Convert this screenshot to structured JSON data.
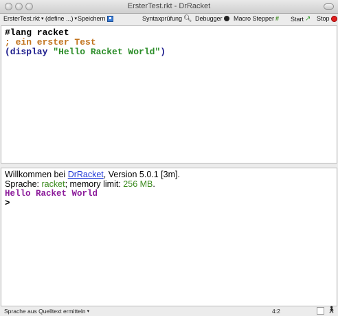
{
  "window": {
    "title": "ErsterTest.rkt - DrRacket"
  },
  "toolbar": {
    "file_menu": "ErsterTest.rkt",
    "define_menu": "(define ...)",
    "save": "Speichern",
    "check_syntax": "Syntaxprüfung",
    "debugger": "Debugger",
    "macro_stepper": "Macro Stepper",
    "macro_stepper_mark": "#",
    "run": "Start",
    "stop": "Stop",
    "dropdown_arrow": "▾"
  },
  "definitions": {
    "lines": [
      {
        "parts": [
          "#lang racket"
        ]
      },
      {
        "parts": [
          "; ein erster Test"
        ]
      },
      {
        "parts": [
          "(display ",
          "\"Hello Racket World\"",
          ")"
        ]
      }
    ]
  },
  "interactions": {
    "welcome_prefix": "Willkommen bei ",
    "welcome_link": "DrRacket",
    "welcome_suffix": ", Version 5.0.1 [3m].",
    "lang_prefix": "Sprache: ",
    "lang_value": "racket",
    "lang_mid": "; memory limit: ",
    "memory_value": "256 MB",
    "lang_end": ".",
    "output": "Hello Racket World",
    "prompt": ">"
  },
  "status": {
    "language_selector": "Sprache aus Quelltext ermitteln",
    "position": "4:2"
  },
  "colors": {
    "comment": "#c2741f",
    "string": "#2b8d28",
    "output": "#8b1a9a",
    "link": "#1a33d6",
    "stop": "#e02020"
  }
}
